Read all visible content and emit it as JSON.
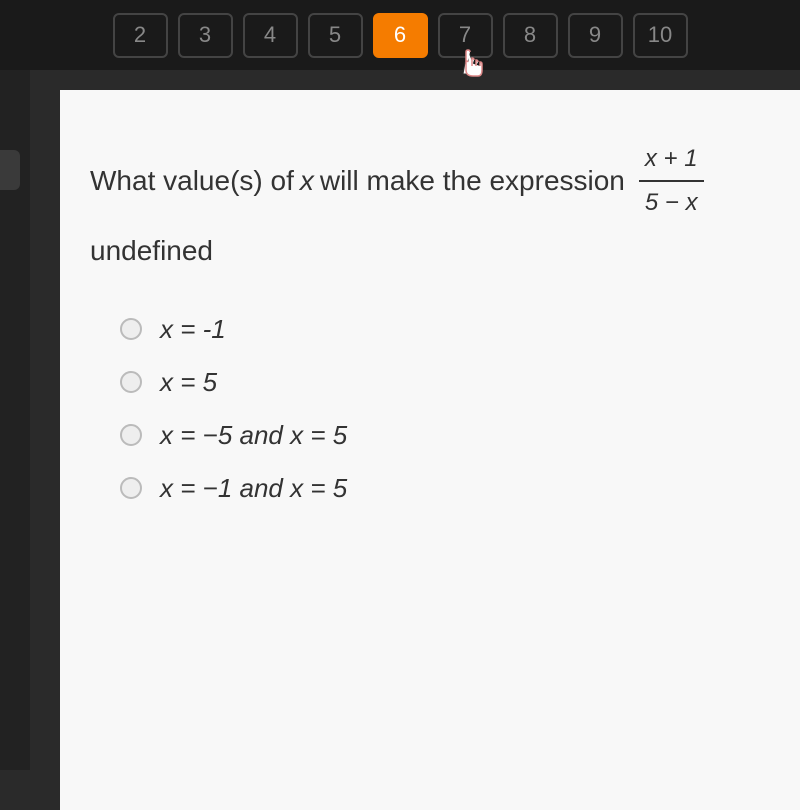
{
  "nav": {
    "items": [
      "2",
      "3",
      "4",
      "5",
      "6",
      "7",
      "8",
      "9",
      "10"
    ],
    "active_index": 4
  },
  "question": {
    "prefix": "What value(s) of ",
    "variable": "x",
    "middle": " will make the expression ",
    "fraction_num": "x + 1",
    "fraction_den": "5 − x",
    "suffix": " undefined"
  },
  "options": [
    "x = -1",
    "x = 5",
    "x = −5  and  x = 5",
    "x = −1  and  x = 5"
  ]
}
